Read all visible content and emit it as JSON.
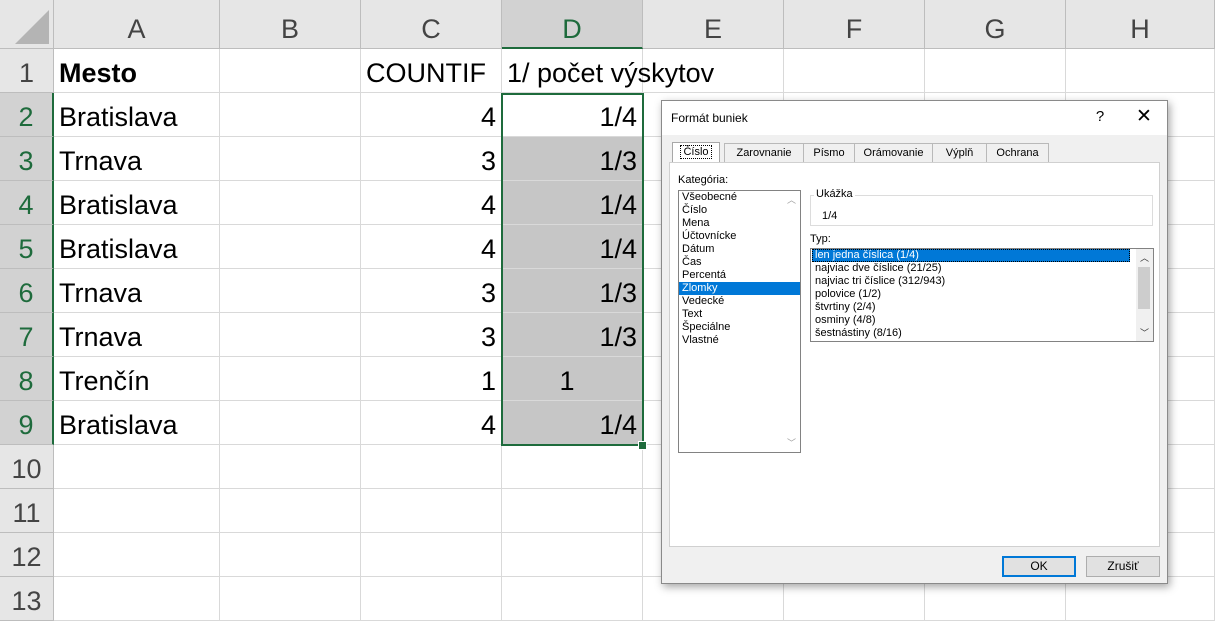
{
  "sheet": {
    "columns": [
      "A",
      "B",
      "C",
      "D",
      "E",
      "F",
      "G",
      "H"
    ],
    "rows": [
      "1",
      "2",
      "3",
      "4",
      "5",
      "6",
      "7",
      "8",
      "9",
      "10",
      "11",
      "12",
      "13"
    ],
    "header": {
      "a": "Mesto",
      "c": "COUNTIF",
      "d": "1/ počet výskytov"
    },
    "data": [
      {
        "a": "Bratislava",
        "c": "4",
        "d": "1/4"
      },
      {
        "a": "Trnava",
        "c": "3",
        "d": "1/3"
      },
      {
        "a": "Bratislava",
        "c": "4",
        "d": "1/4"
      },
      {
        "a": "Bratislava",
        "c": "4",
        "d": "1/4"
      },
      {
        "a": "Trnava",
        "c": "3",
        "d": "1/3"
      },
      {
        "a": "Trnava",
        "c": "3",
        "d": "1/3"
      },
      {
        "a": "Trenčín",
        "c": "1",
        "d": "1"
      },
      {
        "a": "Bratislava",
        "c": "4",
        "d": "1/4"
      }
    ],
    "selection_color": "#1e6b3c"
  },
  "dialog": {
    "title": "Formát buniek",
    "help": "?",
    "close": "✕",
    "tabs": [
      "Číslo",
      "Zarovnanie",
      "Písmo",
      "Orámovanie",
      "Výplň",
      "Ochrana"
    ],
    "category_label": "Kategória:",
    "categories": [
      "Všeobecné",
      "Číslo",
      "Mena",
      "Účtovnícke",
      "Dátum",
      "Čas",
      "Percentá",
      "Zlomky",
      "Vedecké",
      "Text",
      "Špeciálne",
      "Vlastné"
    ],
    "selected_category": "Zlomky",
    "sample_label": "Ukážka",
    "sample_value": "1/4",
    "type_label": "Typ:",
    "types": [
      "len jedna číslica (1/4)",
      "najviac dve číslice (21/25)",
      "najviac tri číslice (312/943)",
      "polovice (1/2)",
      "štvrtiny (2/4)",
      "osminy (4/8)",
      "šestnástiny (8/16)"
    ],
    "selected_type": "len jedna číslica (1/4)",
    "ok": "OK",
    "cancel": "Zrušiť",
    "accent_color": "#0078d7"
  }
}
